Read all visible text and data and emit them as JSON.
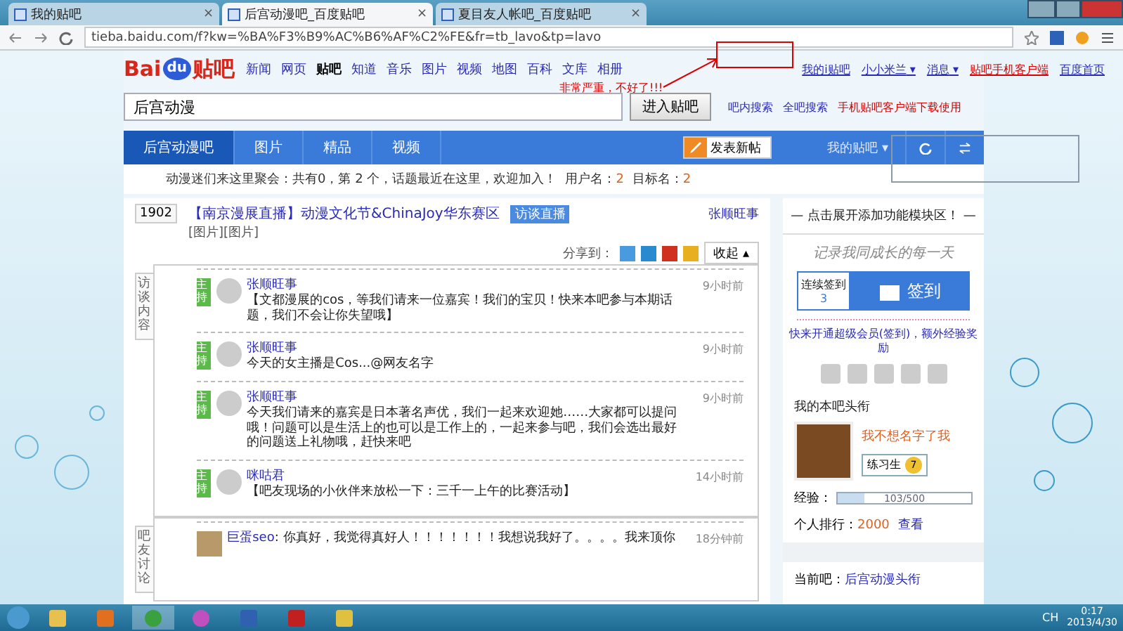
{
  "browser": {
    "tabs": [
      {
        "title": "我的贴吧",
        "selected": false,
        "close": "×"
      },
      {
        "title": "后宫动漫吧_百度贴吧",
        "selected": true,
        "close": "×"
      },
      {
        "title": "夏目友人帐吧_百度贴吧",
        "selected": false,
        "close": "×"
      }
    ],
    "url": "tieba.baidu.com/f?kw=%BA%F3%B9%AC%B6%AF%C2%FE&fr=tb_lavo&tp=lavo"
  },
  "header": {
    "logo": {
      "text": "Bai",
      "badge": "du",
      "suffix": "贴吧"
    },
    "nav": [
      {
        "label": "新闻",
        "selected": false
      },
      {
        "label": "网页",
        "selected": false
      },
      {
        "label": "贴吧",
        "selected": true
      },
      {
        "label": "知道",
        "selected": false
      },
      {
        "label": "音乐",
        "selected": false
      },
      {
        "label": "图片",
        "selected": false
      },
      {
        "label": "视频",
        "selected": false
      },
      {
        "label": "地图",
        "selected": false
      },
      {
        "label": "百科",
        "selected": false
      },
      {
        "label": "文库",
        "selected": false
      },
      {
        "label": "相册",
        "selected": false
      }
    ],
    "user_links": [
      {
        "label": "我的i贴吧",
        "kind": "link"
      },
      {
        "label": "小小米兰",
        "kind": "menu",
        "caret": "▾"
      },
      {
        "label": "消息",
        "kind": "menu",
        "caret": "▾"
      },
      {
        "label": "贴吧手机客户端",
        "kind": "hot"
      },
      {
        "label": "百度首页",
        "kind": "link"
      }
    ],
    "search": {
      "value": "后宫动漫",
      "button": "进入贴吧"
    },
    "search_links": [
      {
        "label": "吧内搜索",
        "kind": "link"
      },
      {
        "label": "全吧搜索",
        "kind": "link"
      },
      {
        "label": "手机贴吧客户端下载使用",
        "kind": "hot"
      }
    ],
    "annotation": "非常严重，不好了!!!"
  },
  "forum_nav": {
    "tabs": [
      {
        "label": "后宫动漫吧",
        "selected": true
      },
      {
        "label": "图片",
        "selected": false
      },
      {
        "label": "精品",
        "selected": false
      },
      {
        "label": "视频",
        "selected": false
      }
    ],
    "post_button": "发表新帖",
    "menu": "我的贴吧",
    "menu_caret": "▾"
  },
  "info": {
    "text": "动漫迷们来这里聚会：共有0，第 2 个，话题最近在这里，欢迎加入！",
    "members_label": "用户名：",
    "members": "2",
    "posts_label": "目标名：",
    "posts": "2"
  },
  "thread": {
    "replies": "1902",
    "title": "【南京漫展直播】动漫文化节&ChinaJoy华东赛区",
    "badge": "访谈直播",
    "author": "张顺旺事",
    "attachments": "[图片][图片]",
    "share_label": "分享到：",
    "collapse": "收起",
    "collapse_caret": "▴",
    "interview_label": "访谈内容",
    "interview": [
      {
        "role": "主持",
        "name": "张顺旺事",
        "text": "【文都漫展的cos，等我们请来一位嘉宾！我们的宝贝！快来本吧参与本期话题，我们不会让你失望哦】",
        "time": "9小时前"
      },
      {
        "role": "主持",
        "name": "张顺旺事",
        "text": "今天的女主播是Cos...@网友名字",
        "time": "9小时前"
      },
      {
        "role": "主持",
        "name": "张顺旺事",
        "text": "今天我们请来的嘉宾是日本著名声优，我们一起来欢迎她……大家都可以提问哦！问题可以是生活上的也可以是工作上的，一起来参与吧，我们会选出最好的问题送上礼物哦，赶快来吧",
        "time": "9小时前"
      },
      {
        "role": "主持",
        "name": "咪咕君",
        "text": "【吧友现场的小伙伴来放松一下：三千一上午的比赛活动】",
        "time": "14小时前"
      }
    ],
    "discussion_label": "吧友讨论",
    "discussion": [
      {
        "name": "巨蛋seo",
        "separator": ":",
        "text": "你真好，我觉得真好人！！！！！！！我想说我好了。。。。我来顶你",
        "time": "18分钟前"
      }
    ]
  },
  "sidebar": {
    "banner": "— 点击展开添加功能模块区！ —",
    "motto": "记录我同成长的每一天",
    "streak_label": "连续签到",
    "streak": "3",
    "sign_button": "签到",
    "promo": "快来开通超级会员(签到)，额外经验奖励",
    "title_heading": "我的本吧头衔",
    "nickname": "我不想名字了我",
    "rank_badge": "练习生",
    "rank_level": "7",
    "exp_label": "经验：",
    "exp": {
      "reading": "103/500",
      "level": 0.2
    },
    "ranking_label": "个人排行：",
    "ranking": "2000",
    "ranking_link": "查看",
    "current_label": "当前吧：",
    "current": "后宫动漫头衔"
  },
  "taskbar": {
    "apps": [
      {
        "kind": "explorer",
        "active": false
      },
      {
        "kind": "media",
        "active": false
      },
      {
        "kind": "chrome",
        "active": true
      },
      {
        "kind": "picasa",
        "active": false
      },
      {
        "kind": "tasks",
        "active": false
      },
      {
        "kind": "flash",
        "active": false
      },
      {
        "kind": "search",
        "active": false
      }
    ],
    "language": "CH",
    "time": "0:17",
    "date": "2013/4/30"
  }
}
